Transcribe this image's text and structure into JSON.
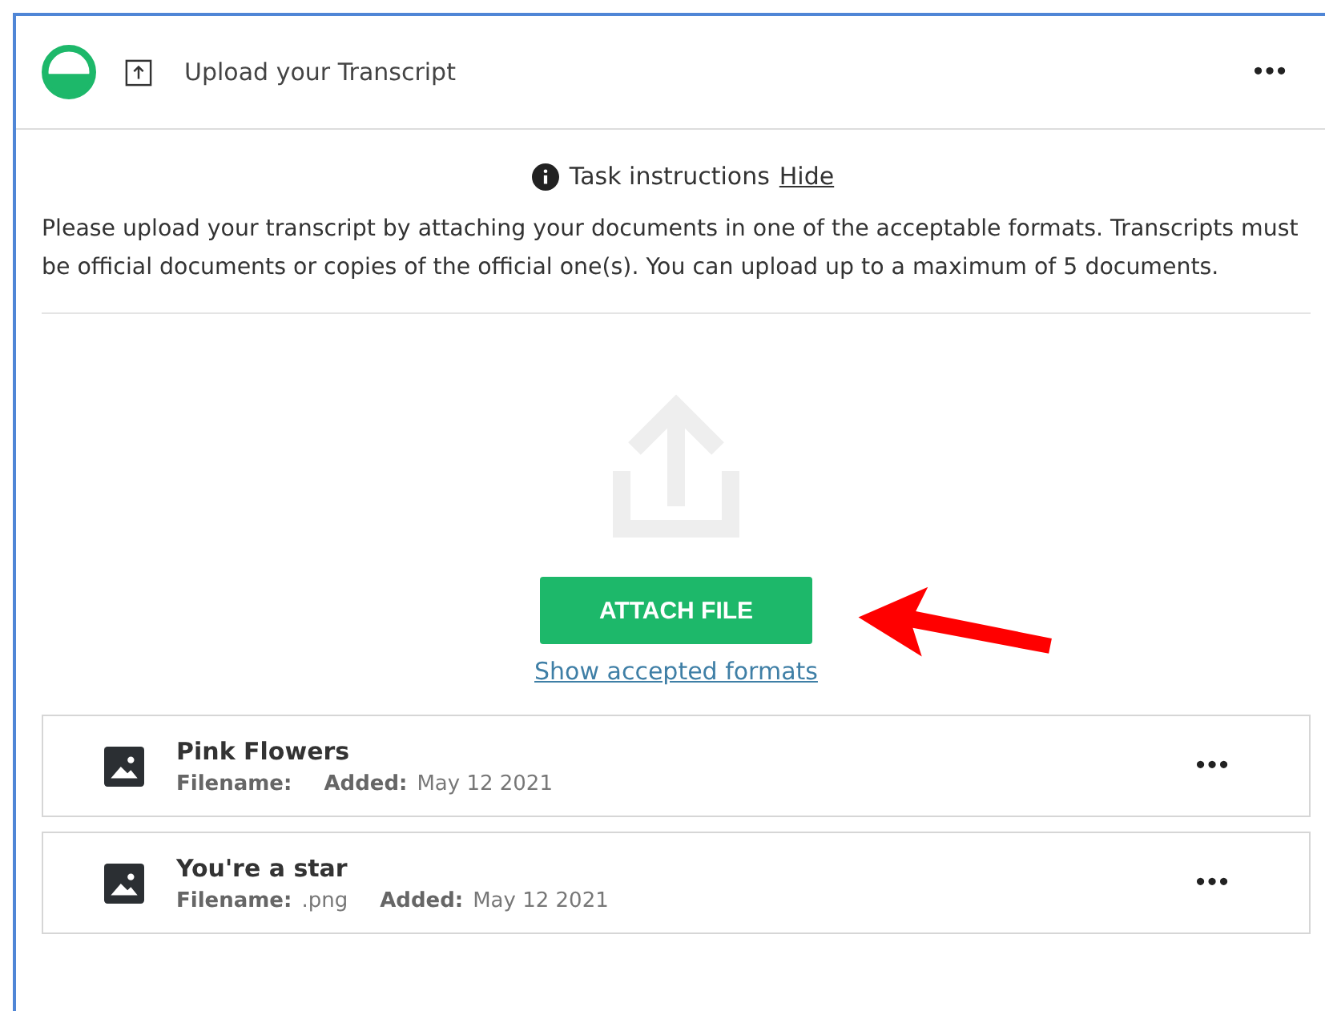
{
  "header": {
    "title": "Upload your Transcript",
    "more": "•••"
  },
  "instructions": {
    "label": "Task instructions",
    "link": "Hide"
  },
  "description": "Please upload your transcript by attaching your documents in one of the acceptable formats. Transcripts must be official documents or copies of the official one(s). You can upload up to a maximum of 5 documents.",
  "attach_button": "ATTACH FILE",
  "formats_link": "Show accepted formats",
  "files": [
    {
      "name": "Pink Flowers",
      "filename_label": "Filename:",
      "added_label": "Added:",
      "added": "May 12 2021",
      "more": "•••"
    },
    {
      "name": "You're a star",
      "filename_label": "Filename:",
      "filename": ".png",
      "added_label": "Added:",
      "added": "May 12 2021",
      "more": "•••"
    }
  ]
}
